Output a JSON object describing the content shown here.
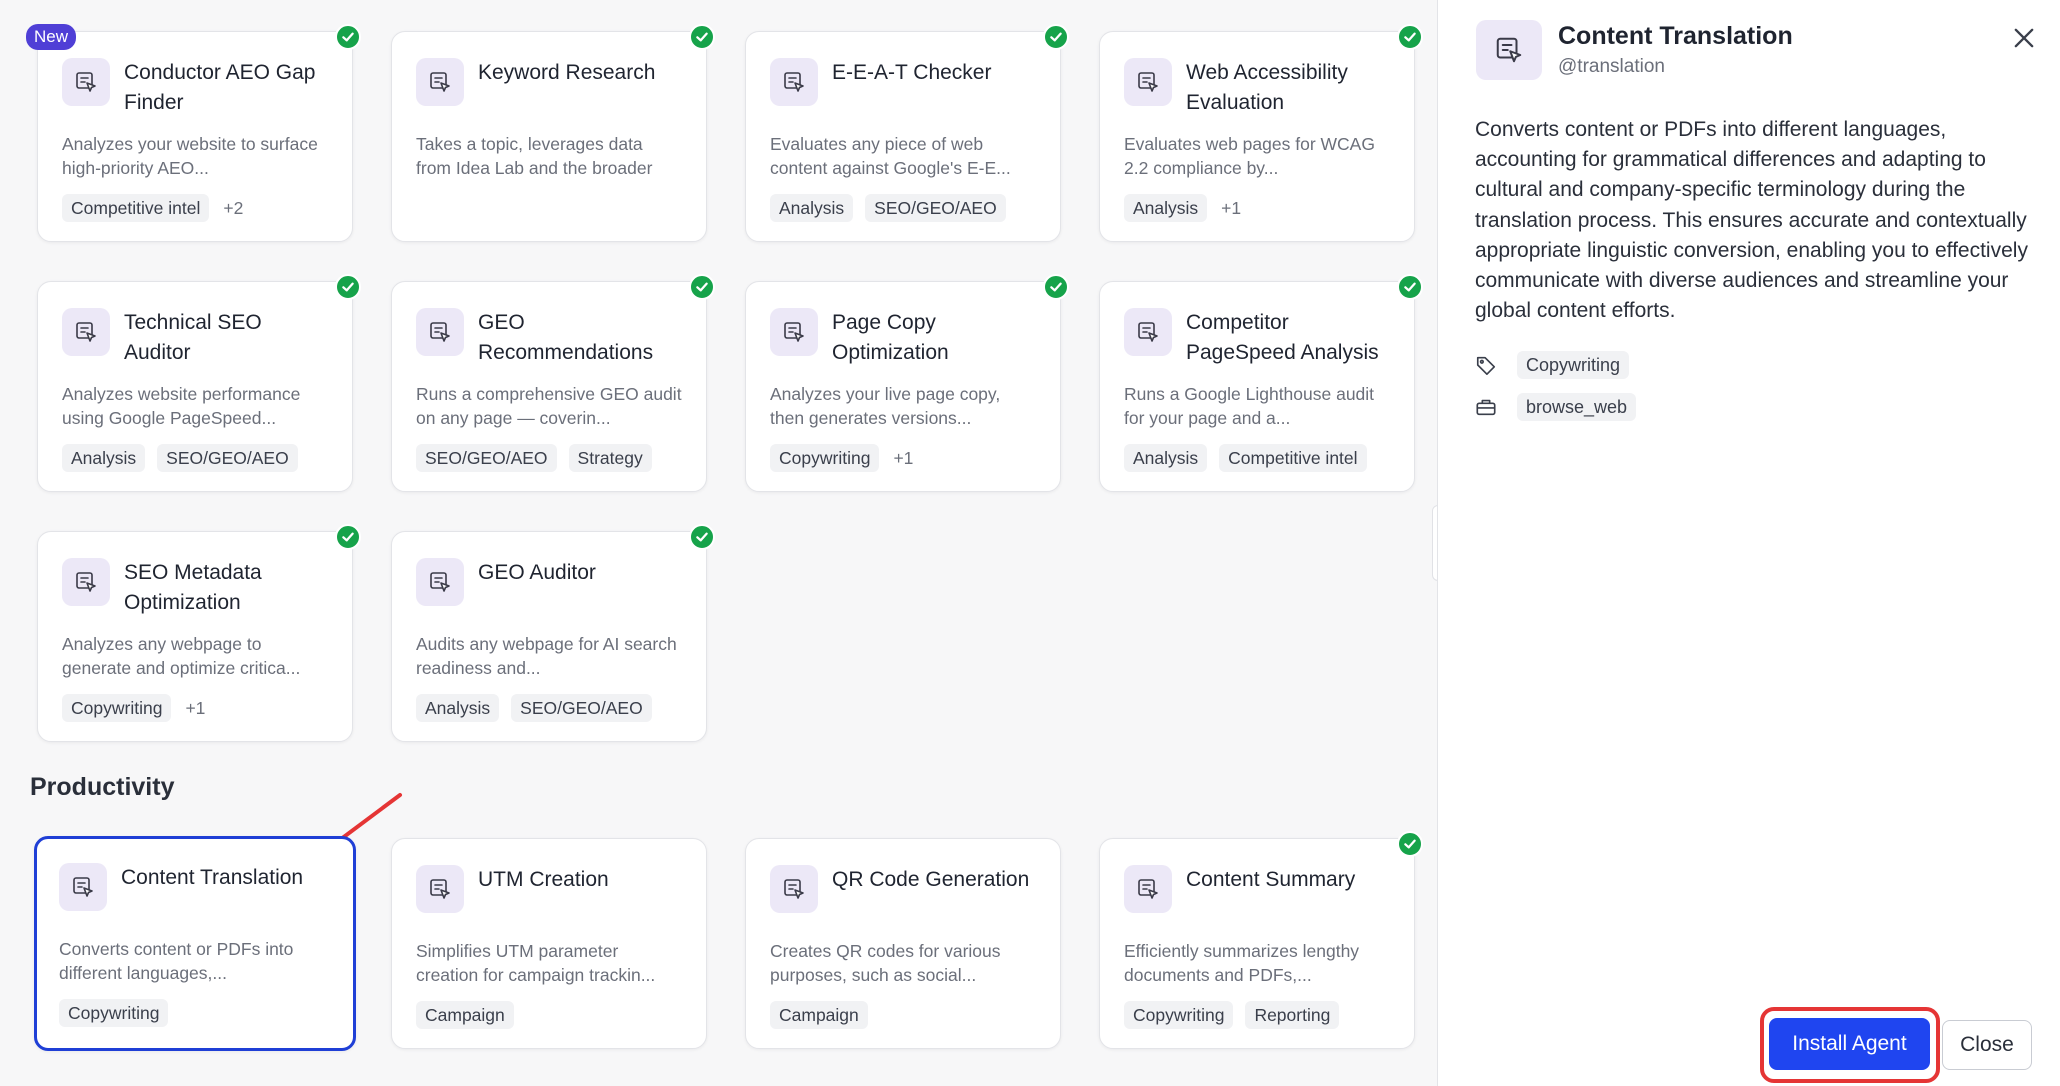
{
  "colors": {
    "accent": "#1f45f0",
    "check": "#16a34a",
    "new_badge": "#4f3fd6",
    "highlight": "#e53535",
    "selected_border": "#1f3fd6"
  },
  "badge_new": "New",
  "cards": [
    {
      "title": "Conductor AEO Gap Finder",
      "desc": "Analyzes your website to surface high-priority AEO...",
      "tags": [
        "Competitive intel"
      ],
      "more": "+2",
      "installed": true,
      "new": true
    },
    {
      "title": "Keyword Research",
      "desc": "Takes a topic, leverages data from Idea Lab and the broader web, and returns a curated li...",
      "tags": [],
      "more": "",
      "installed": true
    },
    {
      "title": "E-E-A-T Checker",
      "desc": "Evaluates any piece of web content against Google's E-E...",
      "tags": [
        "Analysis",
        "SEO/GEO/AEO"
      ],
      "more": "",
      "installed": true
    },
    {
      "title": "Web Accessibility Evaluation",
      "desc": "Evaluates web pages for WCAG 2.2 compliance by...",
      "tags": [
        "Analysis"
      ],
      "more": "+1",
      "installed": true
    },
    {
      "title": "Technical SEO Auditor",
      "desc": "Analyzes website performance using Google PageSpeed...",
      "tags": [
        "Analysis",
        "SEO/GEO/AEO"
      ],
      "more": "",
      "installed": true
    },
    {
      "title": "GEO Recommendations",
      "desc": "Runs a comprehensive GEO audit on any page — coverin...",
      "tags": [
        "SEO/GEO/AEO",
        "Strategy"
      ],
      "more": "",
      "installed": true
    },
    {
      "title": "Page Copy Optimization",
      "desc": "Analyzes your live page copy, then generates versions...",
      "tags": [
        "Copywriting"
      ],
      "more": "+1",
      "installed": true
    },
    {
      "title": "Competitor PageSpeed Analysis",
      "desc": "Runs a Google Lighthouse audit for your page and a...",
      "tags": [
        "Analysis",
        "Competitive intel"
      ],
      "more": "",
      "installed": true
    },
    {
      "title": "SEO Metadata Optimization",
      "desc": "Analyzes any webpage to generate and optimize critica...",
      "tags": [
        "Copywriting"
      ],
      "more": "+1",
      "installed": true
    },
    {
      "title": "GEO Auditor",
      "desc": "Audits any webpage for AI search readiness and...",
      "tags": [
        "Analysis",
        "SEO/GEO/AEO"
      ],
      "more": "",
      "installed": true
    }
  ],
  "section_productivity": "Productivity",
  "prod_cards": [
    {
      "title": "Content Translation",
      "desc": "Converts content or PDFs into different languages,...",
      "tags": [
        "Copywriting"
      ],
      "more": "",
      "installed": false,
      "selected": true
    },
    {
      "title": "UTM Creation",
      "desc": "Simplifies UTM parameter creation for campaign trackin...",
      "tags": [
        "Campaign"
      ],
      "more": "",
      "installed": false
    },
    {
      "title": "QR Code Generation",
      "desc": "Creates QR codes for various purposes, such as social...",
      "tags": [
        "Campaign"
      ],
      "more": "",
      "installed": false
    },
    {
      "title": "Content Summary",
      "desc": "Efficiently summarizes lengthy documents and PDFs,...",
      "tags": [
        "Copywriting",
        "Reporting"
      ],
      "more": "",
      "installed": true
    }
  ],
  "panel": {
    "title": "Content Translation",
    "handle": "@translation",
    "description": "Converts content or PDFs into different languages, accounting for grammatical differences and adapting to cultural and company-specific terminology during the translation process. This ensures accurate and contextually appropriate linguistic conversion, enabling you to effectively communicate with diverse audiences and streamline your global content efforts.",
    "category_tag": "Copywriting",
    "tool_tag": "browse_web",
    "install_label": "Install Agent",
    "close_label": "Close"
  }
}
